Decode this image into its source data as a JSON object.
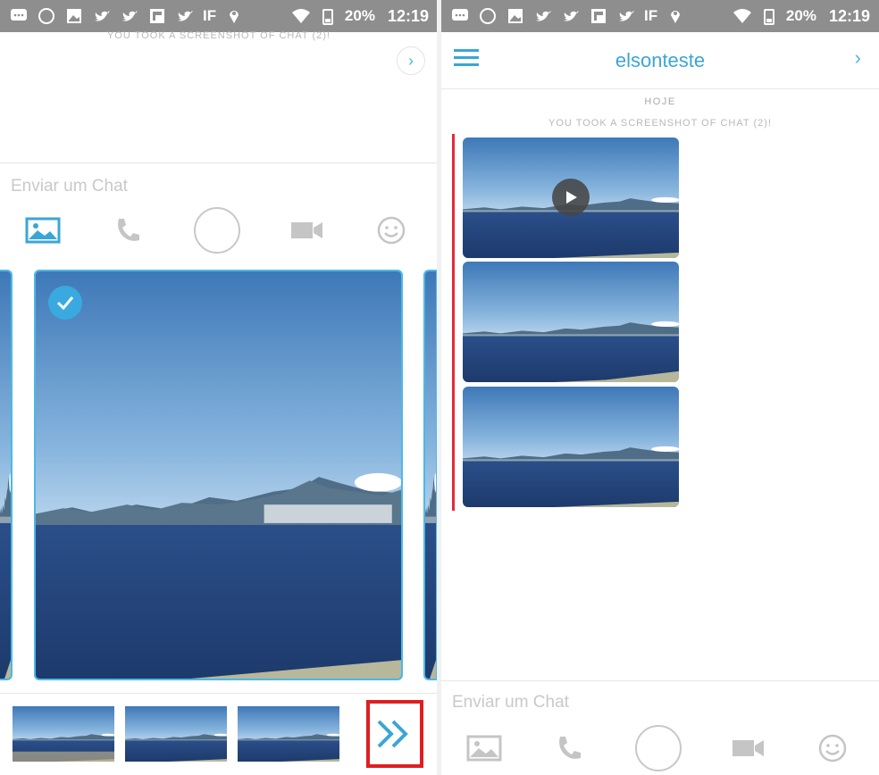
{
  "status_bar": {
    "battery": "20%",
    "time": "12:19",
    "icons": [
      "message-icon",
      "whatsapp-icon",
      "image-icon",
      "twitter-icon",
      "twitter-icon",
      "flipboard-icon",
      "twitter-icon",
      "ifttt-icon",
      "location-icon",
      "wifi-icon",
      "battery-icon"
    ],
    "ifttt_text": "IF"
  },
  "left_screen": {
    "top_note": "YOU TOOK A SCREENSHOT OF CHAT (2)!",
    "forward_glyph": "›",
    "chat_placeholder": "Enviar um Chat",
    "tools": [
      "gallery-icon",
      "phone-icon",
      "capture-button",
      "video-icon",
      "emoji-icon"
    ],
    "selected_photo": {
      "selected": true
    },
    "thumbnails": 3,
    "send_glyph": "»"
  },
  "right_screen": {
    "title": "elsonteste",
    "date_label": "HOJE",
    "note": "YOU TOOK A SCREENSHOT OF CHAT (2)!",
    "chevron": "›",
    "messages": [
      "video",
      "photo",
      "photo"
    ],
    "chat_placeholder": "Enviar um Chat"
  },
  "colors": {
    "accent": "#3aa6d6",
    "selection": "#4db8e6",
    "highlight": "#e01d20",
    "status_bar": "#8e8e8e",
    "red_bar": "#e22a3b"
  }
}
